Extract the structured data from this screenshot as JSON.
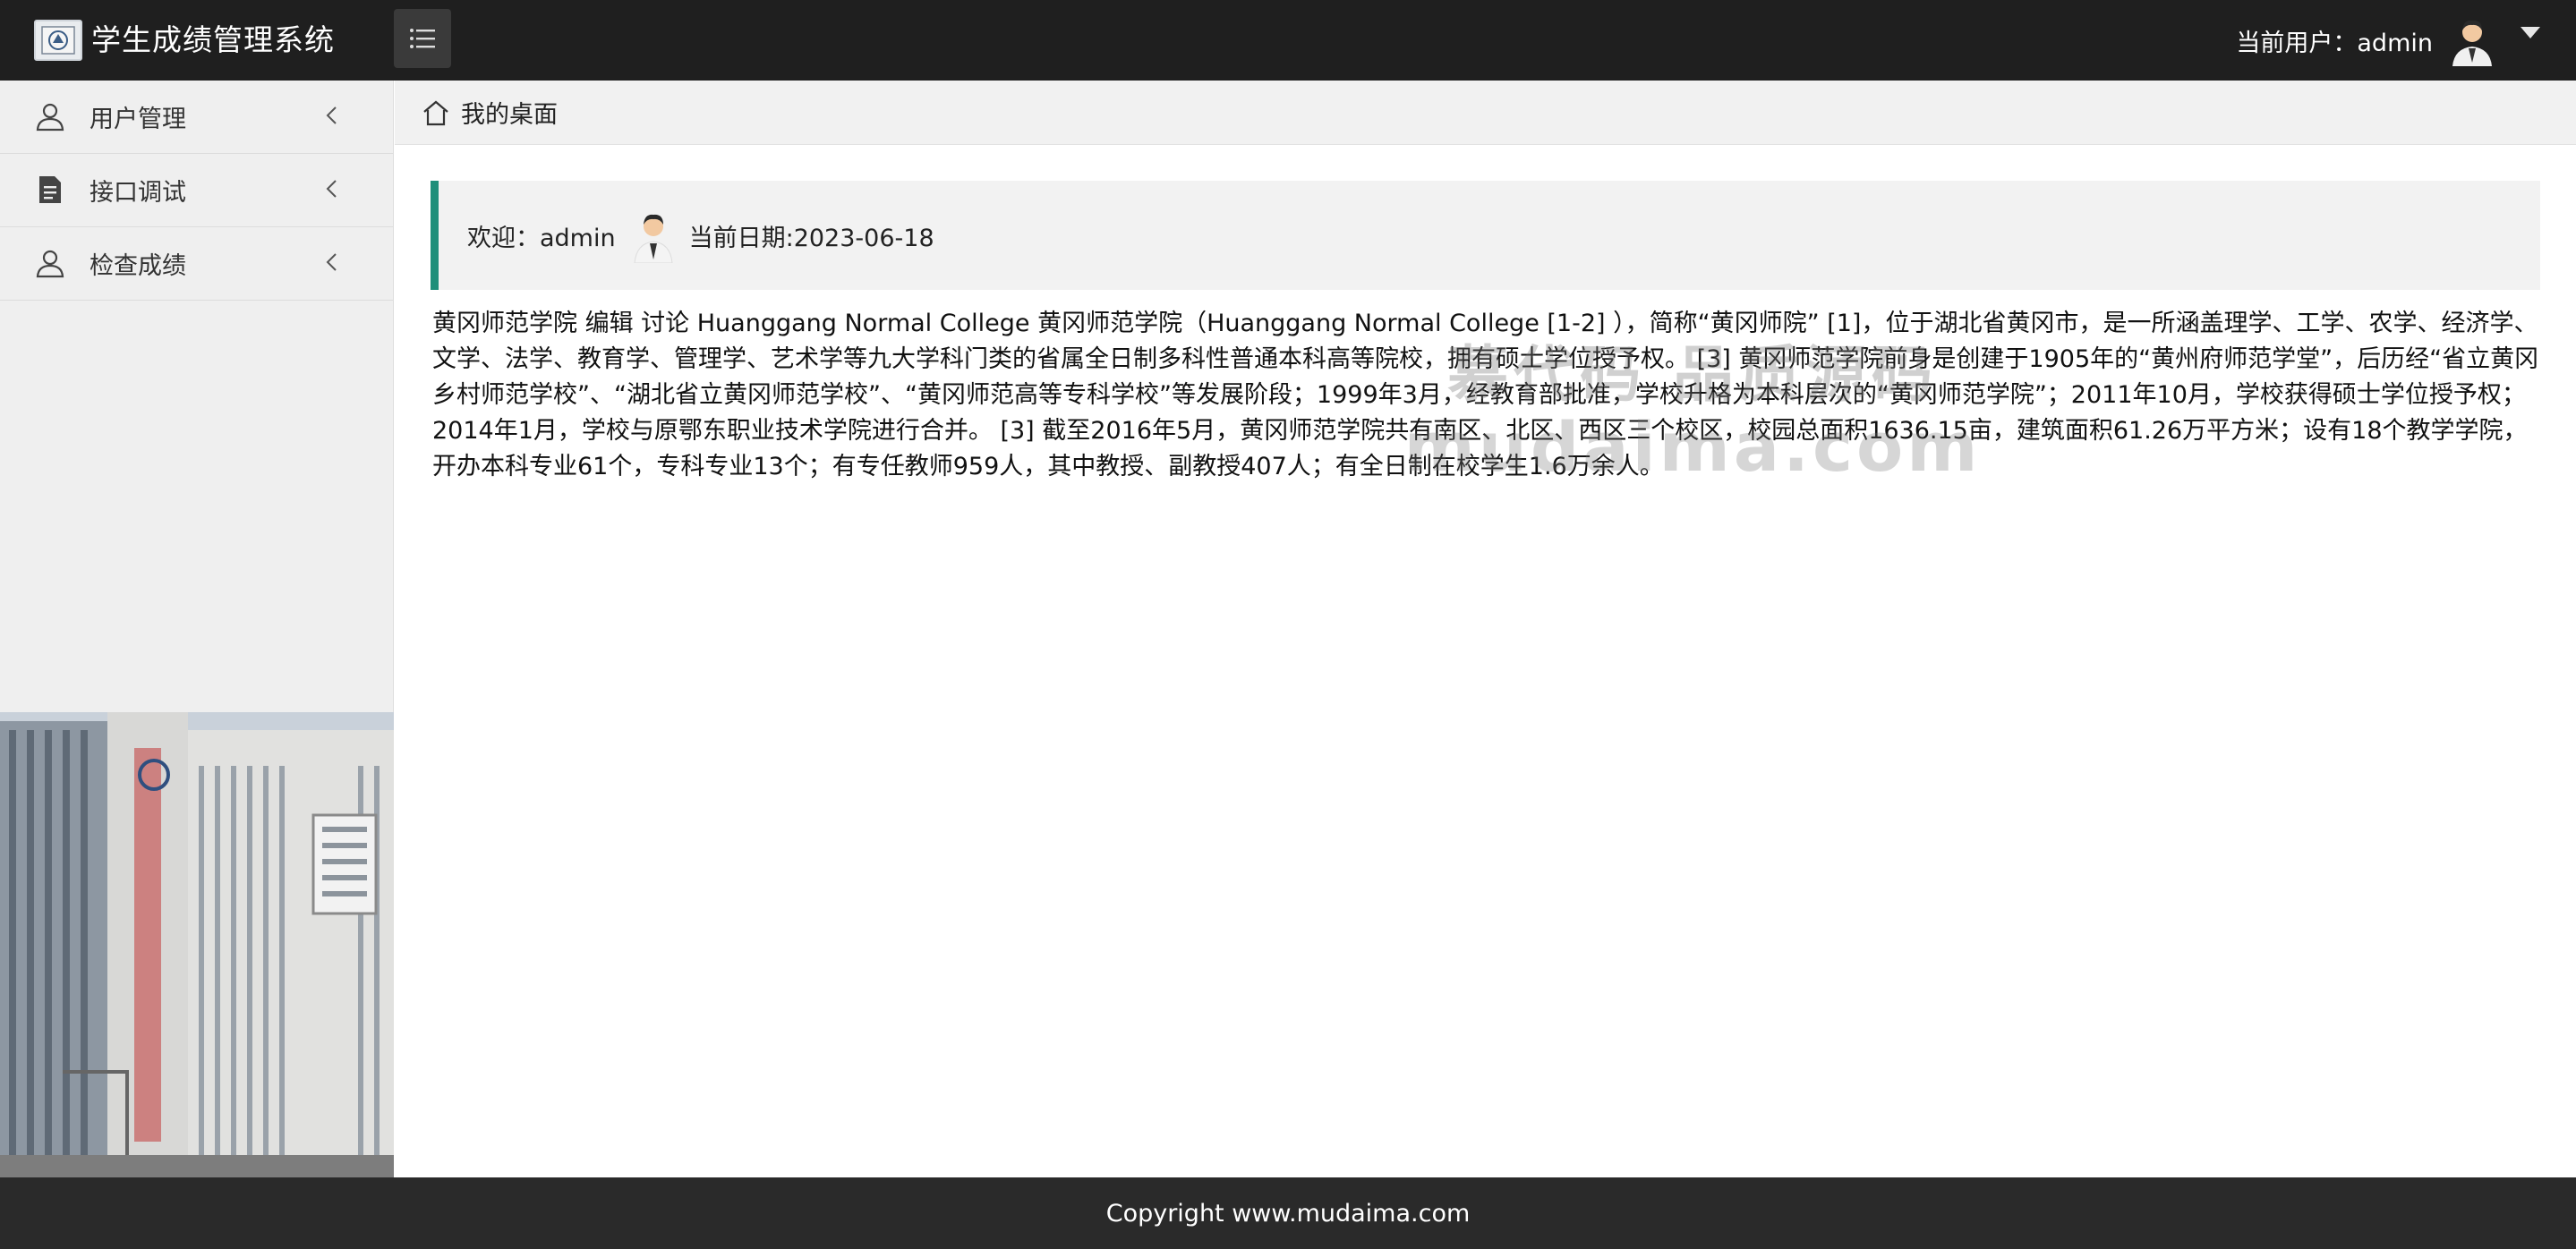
{
  "header": {
    "app_title": "学生成绩管理系统",
    "current_user_label": "当前用户：admin",
    "menu_toggle_icon": "list-icon",
    "user_dropdown_icon": "caret-down-icon"
  },
  "sidebar": {
    "items": [
      {
        "label": "用户管理",
        "icon": "user-icon"
      },
      {
        "label": "接口调试",
        "icon": "document-icon"
      },
      {
        "label": "检查成绩",
        "icon": "user-icon"
      }
    ]
  },
  "breadcrumb": {
    "icon": "home-icon",
    "label": "我的桌面"
  },
  "welcome": {
    "greeting": "欢迎：admin",
    "date": "当前日期:2023-06-18"
  },
  "intro_text": "黄冈师范学院 编辑 讨论 Huanggang Normal College 黄冈师范学院（Huanggang Normal College [1-2] ），简称“黄冈师院” [1]，位于湖北省黄冈市，是一所涵盖理学、工学、农学、经济学、文学、法学、教育学、管理学、艺术学等九大学科门类的省属全日制多科性普通本科高等院校，拥有硕士学位授予权。 [3] 黄冈师范学院前身是创建于1905年的“黄州府师范学堂”，后历经“省立黄冈乡村师范学校”、“湖北省立黄冈师范学校”、“黄冈师范高等专科学校”等发展阶段；1999年3月，经教育部批准，学校升格为本科层次的“黄冈师范学院”；2011年10月，学校获得硕士学位授予权；2014年1月，学校与原鄂东职业技术学院进行合并。 [3] 截至2016年5月，黄冈师范学院共有南区、北区、西区三个校区，校园总面积1636.15亩，建筑面积61.26万平方米；设有18个教学学院，开办本科专业61个，专科专业13个；有专任教师959人，其中教授、副教授407人；有全日制在校学生1.6万余人。",
  "watermark": {
    "line1": "慕代码 品质源码",
    "line2": "mudaima.com"
  },
  "footer": {
    "copyright": "Copyright www.mudaima.com"
  },
  "colors": {
    "topbar": "#1f1f1f",
    "accent_border": "#1f8f7a",
    "footer": "#2a2a2a"
  }
}
